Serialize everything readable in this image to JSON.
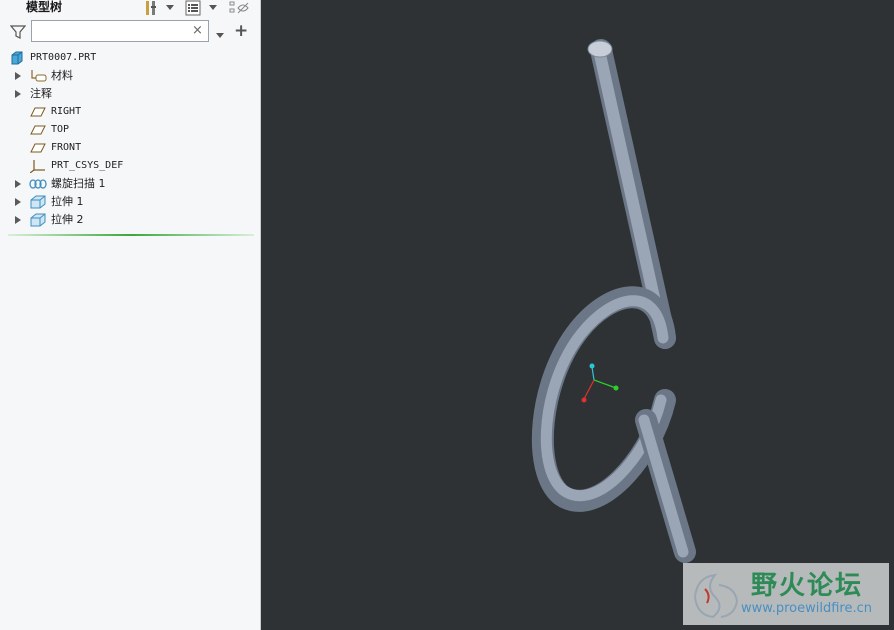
{
  "panel": {
    "title": "模型树",
    "search": {
      "value": "",
      "placeholder": ""
    },
    "clear_glyph": "×",
    "add_glyph": "+",
    "tree": [
      {
        "label": "PRT0007.PRT",
        "icon": "part-icon",
        "expandable": false,
        "mono": true
      },
      {
        "label": "材料",
        "icon": "material-icon",
        "expandable": true,
        "mono": false
      },
      {
        "label": "注释",
        "icon": "",
        "expandable": true,
        "mono": false
      },
      {
        "label": "RIGHT",
        "icon": "datum-plane-icon",
        "expandable": false,
        "mono": true
      },
      {
        "label": "TOP",
        "icon": "datum-plane-icon",
        "expandable": false,
        "mono": true
      },
      {
        "label": "FRONT",
        "icon": "datum-plane-icon",
        "expandable": false,
        "mono": true
      },
      {
        "label": "PRT_CSYS_DEF",
        "icon": "csys-icon",
        "expandable": false,
        "mono": true
      },
      {
        "label": "螺旋扫描 1",
        "icon": "helical-sweep-icon",
        "expandable": true,
        "mono": false
      },
      {
        "label": "拉伸 1",
        "icon": "extrude-icon",
        "expandable": true,
        "mono": false
      },
      {
        "label": "拉伸 2",
        "icon": "extrude-icon",
        "expandable": true,
        "mono": false
      }
    ]
  },
  "watermark": {
    "title": "野火论坛",
    "url": "www.proewildfire.cn"
  },
  "colors": {
    "viewport_bg": "#2e3234",
    "panel_bg": "#f6f7f9",
    "model": "#8a96a6",
    "accent_green": "#3aa83a"
  }
}
